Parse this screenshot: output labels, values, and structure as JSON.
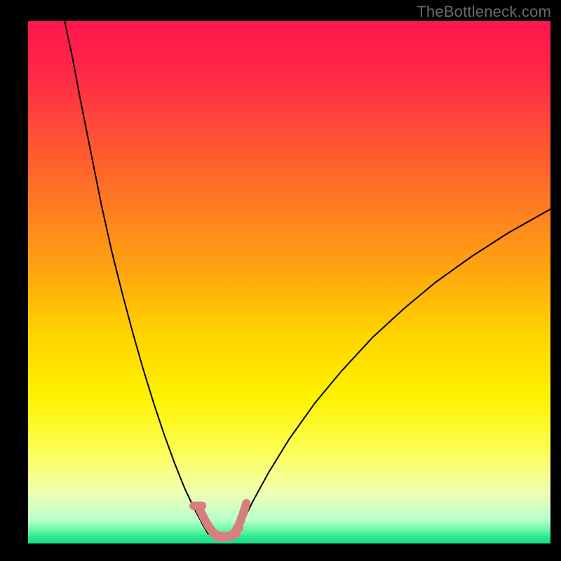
{
  "watermark": "TheBottleneck.com",
  "chart_data": {
    "type": "line",
    "title": "",
    "xlabel": "",
    "ylabel": "",
    "xlim": [
      0,
      100
    ],
    "ylim": [
      0,
      100
    ],
    "grid": false,
    "legend": false,
    "background": {
      "type": "vertical-gradient",
      "stops": [
        {
          "pos": 0.0,
          "color": "#ff154d"
        },
        {
          "pos": 0.1,
          "color": "#ff2846"
        },
        {
          "pos": 0.22,
          "color": "#ff5035"
        },
        {
          "pos": 0.35,
          "color": "#ff7a22"
        },
        {
          "pos": 0.48,
          "color": "#ffa60f"
        },
        {
          "pos": 0.6,
          "color": "#ffd400"
        },
        {
          "pos": 0.72,
          "color": "#fff200"
        },
        {
          "pos": 0.82,
          "color": "#fdff52"
        },
        {
          "pos": 0.9,
          "color": "#f1ffb0"
        },
        {
          "pos": 0.955,
          "color": "#b9ffcf"
        },
        {
          "pos": 0.975,
          "color": "#66f7a3"
        },
        {
          "pos": 0.99,
          "color": "#25e38b"
        },
        {
          "pos": 1.0,
          "color": "#1de08b"
        }
      ]
    },
    "series": [
      {
        "name": "left-branch",
        "stroke": "#000000",
        "stroke_width": 2,
        "x": [
          7.0,
          8.5,
          10.0,
          12.0,
          14.0,
          16.0,
          18.0,
          20.0,
          22.0,
          24.0,
          26.0,
          28.0,
          30.0,
          32.0,
          33.5,
          34.5
        ],
        "y": [
          100,
          93,
          85,
          75,
          65,
          56,
          48,
          40.5,
          33.5,
          27,
          21,
          15.5,
          10.5,
          6.3,
          3.5,
          1.8
        ]
      },
      {
        "name": "right-branch",
        "stroke": "#000000",
        "stroke_width": 2,
        "x": [
          39.5,
          41.0,
          43.0,
          46.0,
          50.0,
          55.0,
          60.0,
          66.0,
          72.0,
          78.0,
          85.0,
          92.0,
          100.0
        ],
        "y": [
          1.8,
          4.0,
          8.0,
          13.5,
          20.0,
          27.0,
          33.0,
          39.5,
          45.0,
          50.0,
          55.0,
          59.5,
          64.0
        ]
      },
      {
        "name": "marker-trace",
        "stroke": "#d77f7f",
        "stroke_width": 12,
        "linecap": "round",
        "x": [
          32.5,
          33.3,
          34.1,
          34.9,
          35.7,
          36.5,
          37.3,
          38.1,
          38.9,
          39.7,
          40.3,
          40.9,
          41.5
        ],
        "y": [
          7.2,
          5.6,
          4.1,
          2.8,
          1.9,
          1.5,
          1.4,
          1.4,
          1.6,
          2.3,
          3.5,
          5.0,
          6.8
        ]
      }
    ]
  }
}
